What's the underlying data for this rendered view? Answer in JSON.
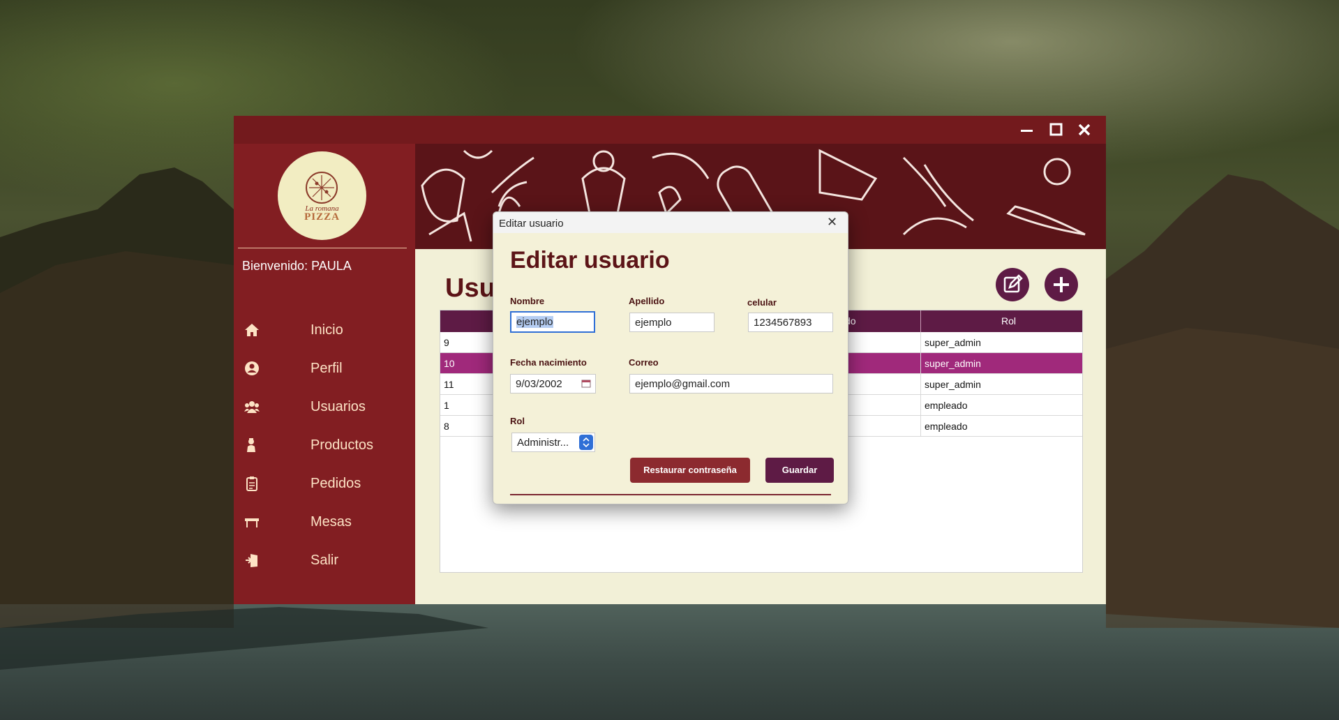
{
  "window": {
    "controls": {
      "minimize": "—",
      "maximize": "☐",
      "close": "✕"
    },
    "colors": {
      "titlebar": "#731a1d",
      "sidebar": "#821e22",
      "accent": "#5e1b45",
      "selected_row": "#a0297b"
    }
  },
  "logo": {
    "line1": "La romana",
    "line2": "PIZZA"
  },
  "sidebar": {
    "welcome": "Bienvenido: PAULA",
    "items": [
      {
        "label": "Inicio",
        "icon": "home-icon"
      },
      {
        "label": "Perfil",
        "icon": "user-circle-icon"
      },
      {
        "label": "Usuarios",
        "icon": "users-icon"
      },
      {
        "label": "Productos",
        "icon": "chef-icon"
      },
      {
        "label": "Pedidos",
        "icon": "clipboard-icon"
      },
      {
        "label": "Mesas",
        "icon": "table-icon"
      },
      {
        "label": "Salir",
        "icon": "exit-door-icon"
      }
    ]
  },
  "main": {
    "title": "Usu",
    "table": {
      "headers": {
        "partial": "do",
        "rol": "Rol"
      },
      "rows": [
        {
          "id": "9",
          "rol": "super_admin",
          "selected": false
        },
        {
          "id": "10",
          "rol": "super_admin",
          "selected": true
        },
        {
          "id": "11",
          "rol": "super_admin",
          "selected": false
        },
        {
          "id": "1",
          "rol": "empleado",
          "selected": false
        },
        {
          "id": "8",
          "rol": "empleado",
          "selected": false
        }
      ]
    }
  },
  "dialog": {
    "window_title": "Editar usuario",
    "close": "✕",
    "heading": "Editar usuario",
    "fields": {
      "nombre": {
        "label": "Nombre",
        "value": "ejemplo"
      },
      "apellido": {
        "label": "Apellido",
        "value": "ejemplo"
      },
      "celular": {
        "label": "celular",
        "value": "1234567893"
      },
      "fecha": {
        "label": "Fecha nacimiento",
        "value": "9/03/2002"
      },
      "correo": {
        "label": "Correo",
        "value": "ejemplo@gmail.com"
      },
      "rol": {
        "label": "Rol",
        "value": "Administr..."
      }
    },
    "buttons": {
      "reset": "Restaurar contraseña",
      "save": "Guardar"
    }
  }
}
